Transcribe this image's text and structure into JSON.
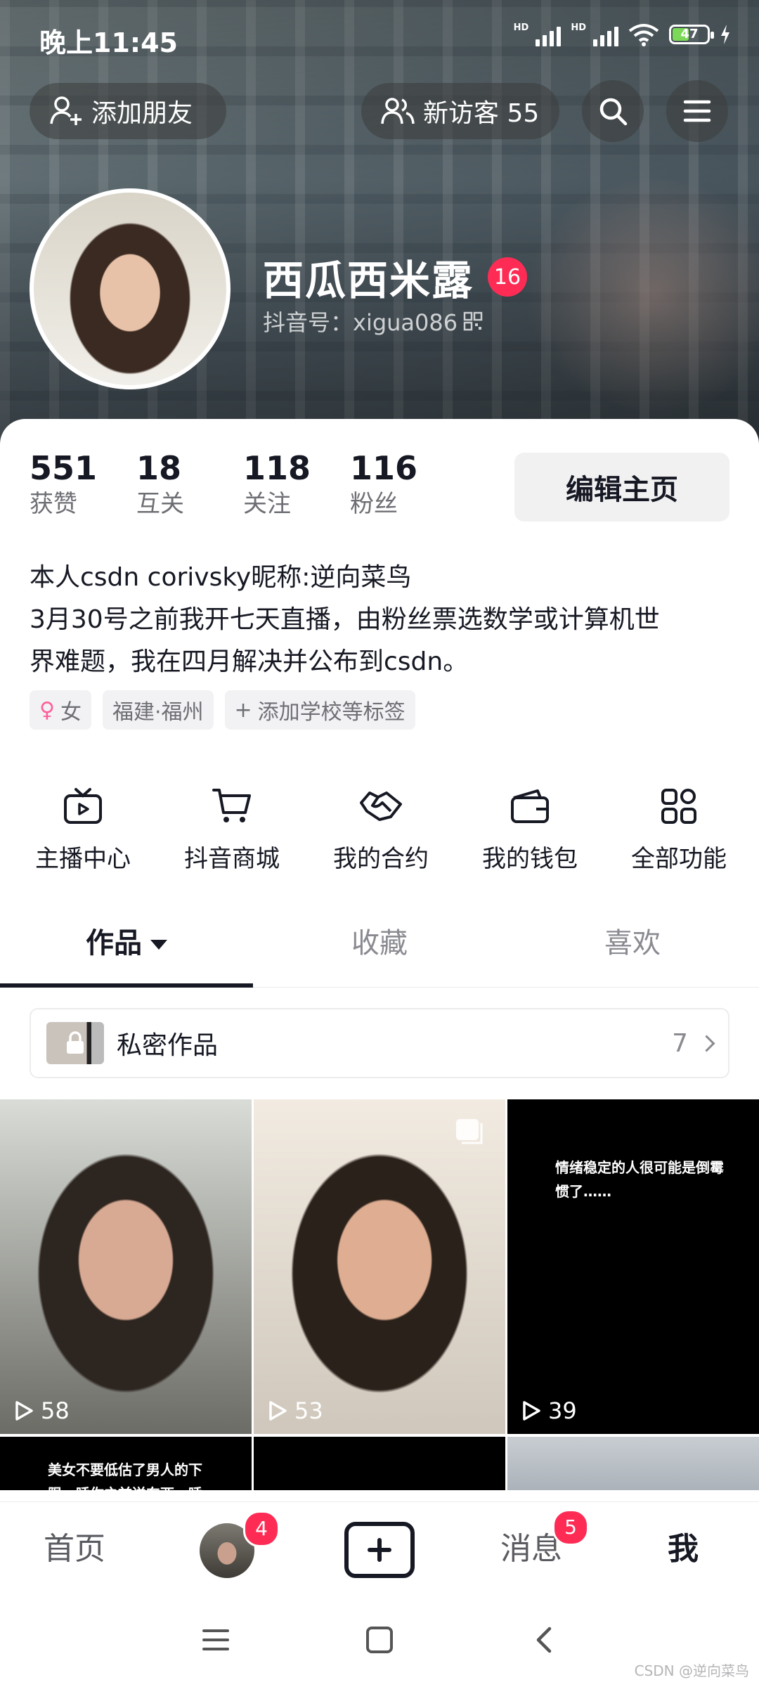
{
  "status_bar": {
    "time": "晚上11:45",
    "battery": "47"
  },
  "header": {
    "add_friend_label": "添加朋友",
    "new_visitors_label": "新访客 55"
  },
  "profile": {
    "name": "西瓜西米露",
    "level": "16",
    "douyin_id": "抖音号：xigua086"
  },
  "stats": [
    {
      "value": "551",
      "label": "获赞"
    },
    {
      "value": "18",
      "label": "互关"
    },
    {
      "value": "118",
      "label": "关注"
    },
    {
      "value": "116",
      "label": "粉丝"
    }
  ],
  "edit_profile_label": "编辑主页",
  "bio": {
    "line1": "本人csdn corivsky昵称:逆向菜鸟",
    "line2": "3月30号之前我开七天直播，由粉丝票选数学或计算机世",
    "line3": "界难题，我在四月解决并公布到csdn。"
  },
  "tags": {
    "gender": "女",
    "location": "福建·福州",
    "add_school": "添加学校等标签"
  },
  "quick_actions": [
    {
      "label": "主播中心",
      "icon": "tv-icon"
    },
    {
      "label": "抖音商城",
      "icon": "cart-icon"
    },
    {
      "label": "我的合约",
      "icon": "handshake-icon"
    },
    {
      "label": "我的钱包",
      "icon": "wallet-icon"
    },
    {
      "label": "全部功能",
      "icon": "grid-icon"
    }
  ],
  "tabs": [
    {
      "label": "作品",
      "active": true
    },
    {
      "label": "收藏",
      "active": false
    },
    {
      "label": "喜欢",
      "active": false
    }
  ],
  "private_works": {
    "label": "私密作品",
    "count": "7"
  },
  "videos": [
    {
      "plays": "58"
    },
    {
      "plays": "53"
    },
    {
      "plays": "39",
      "caption": "情绪稳定的人很可能是倒霉惯了……"
    },
    {
      "caption": "美女不要低估了男人的下限，睡你之前送东西，睡"
    }
  ],
  "bottom_nav": {
    "home": "首页",
    "friends_badge": "4",
    "messages": "消息",
    "messages_badge": "5",
    "me": "我"
  },
  "watermark": "CSDN @逆向菜鸟",
  "colors": {
    "accent": "#fe2c55",
    "text": "#161823",
    "muted": "#6e6f74"
  }
}
